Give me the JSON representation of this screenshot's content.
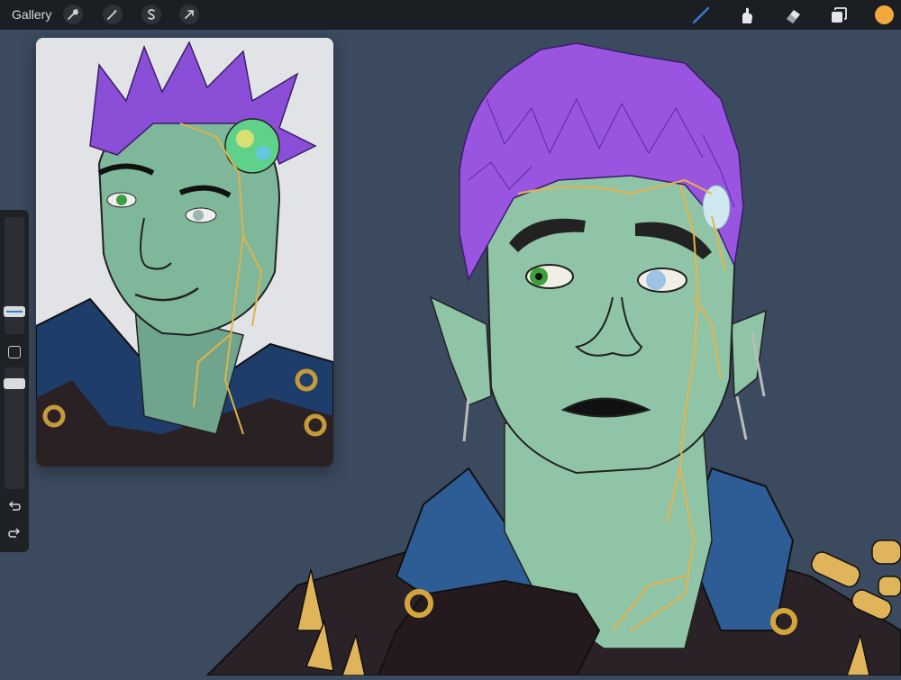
{
  "topbar": {
    "gallery_label": "Gallery",
    "tools_left": [
      "wrench-icon",
      "magic-wand-icon",
      "selection-s-icon",
      "transform-arrow-icon"
    ],
    "tools_right": [
      "brush-icon",
      "smudge-icon",
      "eraser-icon",
      "layers-icon"
    ],
    "active_color": "#f0a93a",
    "active_tool_color": "#3a7bd5"
  },
  "sidebar": {
    "controls": [
      "brush-size-slider",
      "modify-button",
      "opacity-slider",
      "undo-icon",
      "redo-icon"
    ]
  },
  "colors": {
    "canvas_bg": "#3b4a5f",
    "skin": "#8fc5a6",
    "hair": "#9a55e0",
    "gold": "#e8b24a",
    "collar": "#2d5d94",
    "jacket": "#2a2226"
  }
}
